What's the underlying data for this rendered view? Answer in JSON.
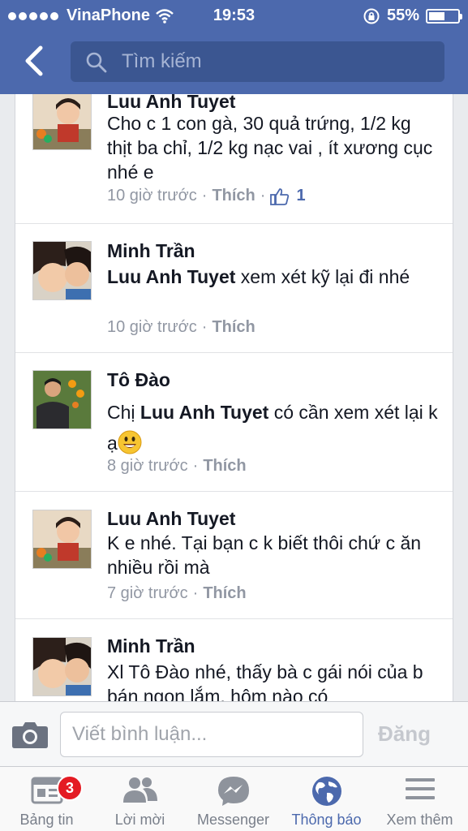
{
  "status_bar": {
    "carrier": "VinaPhone",
    "time": "19:53",
    "battery": "55%",
    "battery_level": 0.55
  },
  "header": {
    "back_icon": "chevron-left-icon",
    "search_placeholder": "Tìm kiếm"
  },
  "comments": [
    {
      "name": "Luu Anh Tuyet",
      "text": "Cho c 1 con gà, 30 quả trứng, 1/2 kg thịt ba chỉ, 1/2 kg nạc vai , ít xương cục nhé e",
      "time": "10 giờ trước",
      "like": "Thích",
      "like_count": "1"
    },
    {
      "name": "Minh Trần",
      "mention": "Luu Anh Tuyet",
      "text": " xem xét kỹ lại đi nhé",
      "time": "10 giờ trước",
      "like": "Thích"
    },
    {
      "name": "Tô Đào",
      "prefix": "Chị ",
      "mention": "Luu Anh Tuyet",
      "text": " có cần xem xét lại k ạ",
      "time": "8 giờ trước",
      "like": "Thích"
    },
    {
      "name": "Luu Anh Tuyet",
      "text": "K e nhé. Tại bạn c k biết thôi chứ c ăn nhiều rồi mà",
      "time": "7 giờ trước",
      "like": "Thích"
    },
    {
      "name": "Minh Trần",
      "text": "Xl Tô Đào nhé, thấy bà c gái nói của b bán ngon lắm, hôm nào có"
    }
  ],
  "composer": {
    "placeholder": "Viết bình luận...",
    "post_label": "Đăng"
  },
  "tabbar": {
    "tabs": [
      {
        "label": "Bảng tin",
        "icon": "news-feed-icon",
        "badge": "3"
      },
      {
        "label": "Lời mời",
        "icon": "friend-requests-icon"
      },
      {
        "label": "Messenger",
        "icon": "messenger-icon"
      },
      {
        "label": "Thông báo",
        "icon": "globe-icon",
        "active": true
      },
      {
        "label": "Xem thêm",
        "icon": "menu-icon"
      }
    ]
  },
  "colors": {
    "brand_blue": "#4c69ad",
    "badge_red": "#e41b23"
  }
}
